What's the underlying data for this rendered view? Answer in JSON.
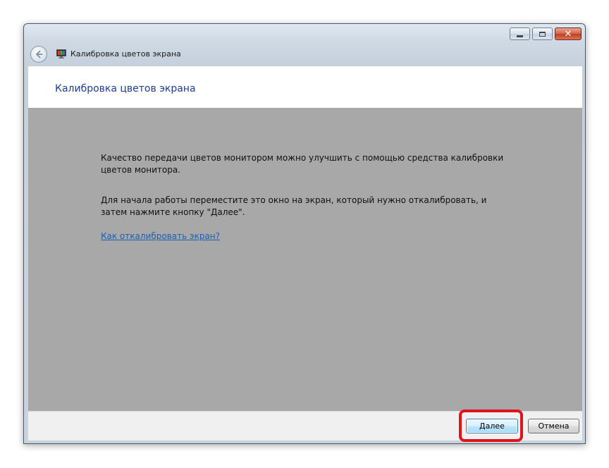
{
  "window": {
    "title": "Калибровка цветов экрана",
    "controls": {
      "minimize": "minimize-icon",
      "maximize": "maximize-icon",
      "close": "close-icon",
      "close_glyph": "✕"
    },
    "back_icon": "back-arrow-icon",
    "app_icon": "color-calibration-icon"
  },
  "header": {
    "title": "Калибровка цветов экрана"
  },
  "content": {
    "paragraph_1": "Качество передачи цветов монитором можно улучшить с помощью средства калибровки цветов монитора.",
    "paragraph_2": "Для начала работы переместите это окно на экран, который нужно откалибровать, и затем нажмите кнопку \"Далее\".",
    "help_link": "Как откалибровать экран?"
  },
  "footer": {
    "next_label": "Далее",
    "cancel_label": "Отмена"
  },
  "colors": {
    "header_title": "#1e3d8f",
    "content_background": "#a8a8a8",
    "link": "#1c5fb4",
    "highlight": "#e0141b"
  }
}
